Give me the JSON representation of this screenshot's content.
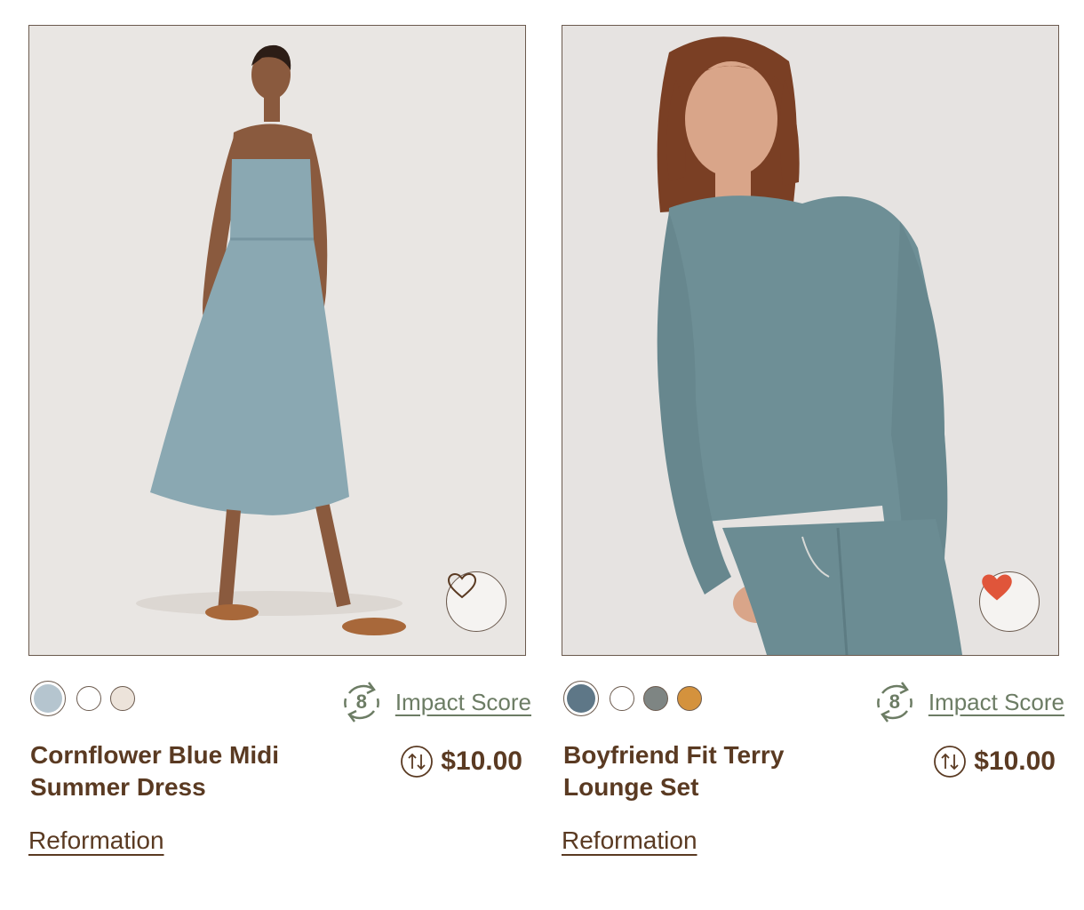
{
  "products": [
    {
      "title": "Cornflower Blue Midi Summer Dress",
      "price": "$10.00",
      "brand": "Reformation",
      "impact_score": "8",
      "impact_label": "Impact Score",
      "favorited": false,
      "swatches": [
        "#b5c5cf",
        "#ffffff",
        "#ece3da"
      ],
      "selected_swatch": 0
    },
    {
      "title": "Boyfriend Fit Terry Lounge Set",
      "price": "$10.00",
      "brand": "Reformation",
      "impact_score": "8",
      "impact_label": "Impact Score",
      "favorited": true,
      "swatches": [
        "#5e7787",
        "#ffffff",
        "#7e8583",
        "#d4923d"
      ],
      "selected_swatch": 0
    }
  ],
  "colors": {
    "text_brown": "#5a3a22",
    "impact_green": "#6c7c64",
    "heart_red": "#e0553a",
    "border": "#6b5a4e"
  },
  "icons": {
    "favorite": "heart-icon",
    "impact": "recycle-score-icon",
    "price_compare": "swap-arrows-icon"
  }
}
